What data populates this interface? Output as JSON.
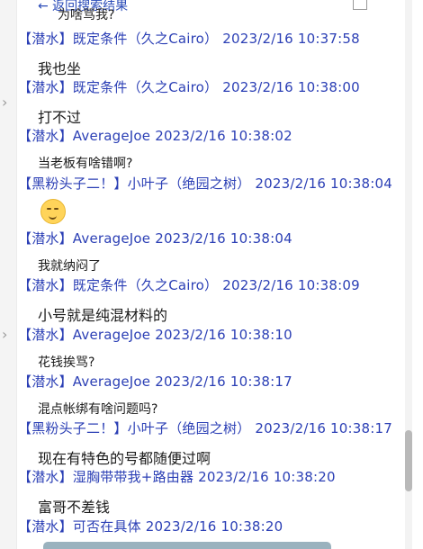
{
  "top": {
    "cut_header": "← 返回搜索结果",
    "cut_message": "为啥骂我?"
  },
  "messages": [
    {
      "header": "【潜水】既定条件（久之Cairo） 2023/2/16 10:37:58",
      "text": "我也坐",
      "size": "large"
    },
    {
      "header": "【潜水】既定条件（久之Cairo） 2023/2/16 10:38:00",
      "text": "打不过",
      "size": "large"
    },
    {
      "header": "【潜水】AverageJoe 2023/2/16 10:38:02",
      "text": "当老板有啥错啊?",
      "size": "small"
    },
    {
      "header": "【黑粉头子二！】小叶子（绝园之树） 2023/2/16 10:38:04",
      "emoji": "relieved-face",
      "size": "large"
    },
    {
      "header": "【潜水】AverageJoe 2023/2/16 10:38:04",
      "text": "我就纳闷了",
      "size": "small"
    },
    {
      "header": "【潜水】既定条件（久之Cairo） 2023/2/16 10:38:09",
      "text": "小号就是纯混材料的",
      "size": "large"
    },
    {
      "header": "【潜水】AverageJoe 2023/2/16 10:38:10",
      "text": "花钱挨骂?",
      "size": "small"
    },
    {
      "header": "【潜水】AverageJoe 2023/2/16 10:38:17",
      "text": "混点帐绑有啥问题吗?",
      "size": "small"
    },
    {
      "header": "【黑粉头子二！】小叶子（绝园之树） 2023/2/16 10:38:17",
      "text": "现在有特色的号都随便过啊",
      "size": "large"
    },
    {
      "header": "【潜水】湿胸带带我+路由器 2023/2/16 10:38:20",
      "text": "富哥不差钱",
      "size": "large"
    },
    {
      "header": "【潜水】可否在具体 2023/2/16 10:38:20",
      "text": "",
      "size": "large"
    }
  ],
  "colors": {
    "header": "#2b3fb5",
    "text": "#1a1a1a",
    "emoji": "#ffd45a"
  }
}
